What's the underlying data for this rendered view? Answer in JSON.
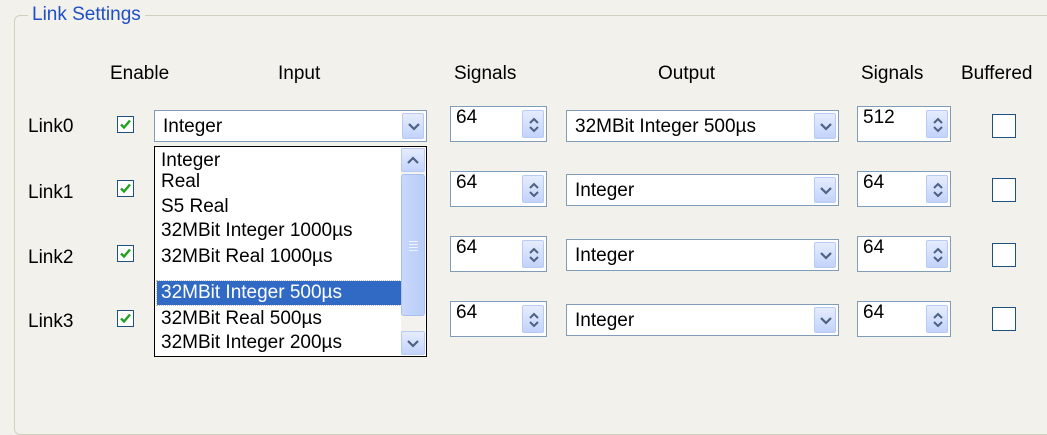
{
  "group": {
    "title": "Link Settings"
  },
  "headers": {
    "enable": "Enable",
    "input": "Input",
    "signals_in": "Signals",
    "output": "Output",
    "signals_out": "Signals",
    "buffered": "Buffered"
  },
  "links": [
    {
      "label": "Link0",
      "enabled": true,
      "input": "Integer",
      "signals_in": "64",
      "output": "32MBit Integer 500µs",
      "signals_out": "512",
      "buffered": false
    },
    {
      "label": "Link1",
      "enabled": true,
      "input": "",
      "signals_in": "64",
      "output": "Integer",
      "signals_out": "64",
      "buffered": false
    },
    {
      "label": "Link2",
      "enabled": true,
      "input": "",
      "signals_in": "64",
      "output": "Integer",
      "signals_out": "64",
      "buffered": false
    },
    {
      "label": "Link3",
      "enabled": true,
      "input": "",
      "signals_in": "64",
      "output": "Integer",
      "signals_out": "64",
      "buffered": false
    }
  ],
  "input_dropdown": {
    "open": true,
    "items": [
      "Integer",
      "Real",
      "S5 Real",
      "32MBit Integer 1000µs",
      "32MBit Real 1000µs",
      "32MBit Integer 500µs",
      "32MBit Real 500µs",
      "32MBit Integer 200µs"
    ],
    "highlighted": "32MBit Integer 500µs"
  },
  "colors": {
    "group_title": "#1f4fc4",
    "selection": "#316ac5",
    "check": "#21a121",
    "border": "#7f9db9"
  }
}
